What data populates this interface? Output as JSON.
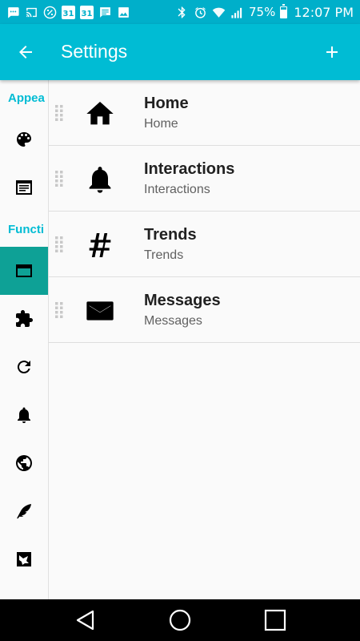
{
  "status_bar": {
    "calendar_day_1": "31",
    "calendar_day_2": "31",
    "battery_percent": "75%",
    "battery_level": 0.75,
    "time": "12:07 PM",
    "left_icons": [
      "chat-icon",
      "cast-icon",
      "percent-icon",
      "calendar-icon",
      "calendar-icon",
      "message-icon",
      "image-icon"
    ],
    "right_icons": [
      "bluetooth-icon",
      "alarm-icon",
      "wifi-icon",
      "signal-icon",
      "battery-icon"
    ]
  },
  "toolbar": {
    "title": "Settings",
    "back_icon": "arrow-back-icon",
    "add_icon": "add-icon",
    "color": "#00bcd4"
  },
  "sidebar": {
    "category_appearance": "Appea",
    "category_functions": "Functi",
    "accent": "#00bcd4",
    "active_color": "#0ea196",
    "items": [
      {
        "icon": "palette-icon",
        "active": false
      },
      {
        "icon": "article-icon",
        "active": false
      },
      {
        "icon": "tab-icon",
        "active": true
      },
      {
        "icon": "puzzle-icon",
        "active": false
      },
      {
        "icon": "refresh-icon",
        "active": false
      },
      {
        "icon": "bell-icon",
        "active": false
      },
      {
        "icon": "globe-icon",
        "active": false
      },
      {
        "icon": "feather-icon",
        "active": false
      },
      {
        "icon": "bird-icon",
        "active": false
      }
    ]
  },
  "tabs": [
    {
      "title": "Home",
      "subtitle": "Home",
      "icon": "home-icon"
    },
    {
      "title": "Interactions",
      "subtitle": "Interactions",
      "icon": "bell-icon"
    },
    {
      "title": "Trends",
      "subtitle": "Trends",
      "icon": "hashtag-icon"
    },
    {
      "title": "Messages",
      "subtitle": "Messages",
      "icon": "envelope-icon"
    }
  ],
  "navbar": {
    "icons": [
      "back-triangle-icon",
      "home-circle-icon",
      "recents-square-icon"
    ]
  }
}
